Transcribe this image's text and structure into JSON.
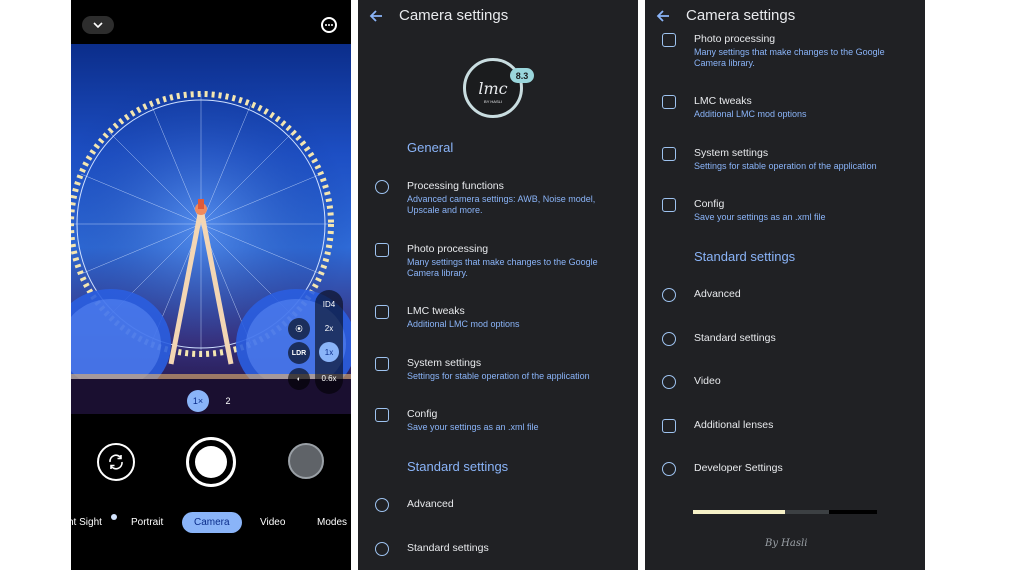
{
  "camera": {
    "zoom_chips": [
      "1×",
      "2"
    ],
    "side_chips": [
      "ID4",
      "2x",
      "1x",
      "0.6x"
    ],
    "left_chips": [
      "LDR"
    ],
    "modes": [
      "ht Sight",
      "Portrait",
      "Camera",
      "Video",
      "Modes"
    ],
    "active_mode": "Camera"
  },
  "settings_left": {
    "title": "Camera settings",
    "version": "8.3",
    "logo_text": "lmc",
    "logo_sub": "BY HASLI",
    "general_label": "General",
    "items": [
      {
        "title": "Processing functions",
        "subtitle": "Advanced camera settings: AWB, Noise model, Upscale and more."
      },
      {
        "title": "Photo processing",
        "subtitle": "Many settings that make changes to the Google Camera library."
      },
      {
        "title": "LMC tweaks",
        "subtitle": "Additional LMC mod options"
      },
      {
        "title": "System settings",
        "subtitle": "Settings for stable operation of the application"
      },
      {
        "title": "Config",
        "subtitle": "Save your settings as an .xml file"
      }
    ],
    "standard_label": "Standard settings",
    "standard_items": [
      "Advanced",
      "Standard settings"
    ]
  },
  "settings_right": {
    "title": "Camera settings",
    "items": [
      {
        "title": "Photo processing",
        "subtitle": "Many settings that make changes to the Google Camera library."
      },
      {
        "title": "LMC tweaks",
        "subtitle": "Additional LMC mod options"
      },
      {
        "title": "System settings",
        "subtitle": "Settings for stable operation of the application"
      },
      {
        "title": "Config",
        "subtitle": "Save your settings as an .xml file"
      }
    ],
    "standard_label": "Standard settings",
    "standard_items": [
      "Advanced",
      "Standard settings",
      "Video",
      "Additional lenses",
      "Developer Settings"
    ],
    "progress": 0.5,
    "signature": "By Hasli"
  },
  "colors": {
    "accent": "#8ab4f8",
    "background": "#202124",
    "text": "#e8eaed"
  }
}
